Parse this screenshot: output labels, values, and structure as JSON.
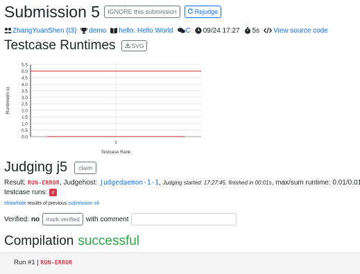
{
  "submission": {
    "title": "Submission 5",
    "ignore_label": "IGNORE this submission",
    "rejudge_label": "Rejudge"
  },
  "meta": {
    "team": "ZhangYuanShen (t3)",
    "contest": "demo",
    "problem": "hello: Hello World",
    "language": "C",
    "time": "09/24 17:27",
    "runtime": "5s",
    "source_link": "View source code"
  },
  "runtimes": {
    "title": "Testcase Runtimes",
    "svg_button": "SVG"
  },
  "chart_data": {
    "type": "bar",
    "categories": [
      "1"
    ],
    "values": [
      0.01
    ],
    "limit_line": 5.0,
    "xlabel": "Testcase Rank",
    "ylabel": "Runtime(in s)",
    "ylim": [
      0,
      5.5
    ],
    "yticks": [
      "0.0",
      "0.5",
      "1.0",
      "1.5",
      "2.0",
      "2.5",
      "3.0",
      "3.5",
      "4.0",
      "4.5",
      "5.0",
      "5.5"
    ],
    "colors": {
      "limit": "#dc3545",
      "bar": "#dc3545",
      "grid": "#e6e6e6"
    }
  },
  "judging": {
    "title": "Judging j5",
    "claim_label": "claim",
    "result_prefix": "Result:",
    "result": "RUN-ERROR",
    "judgehost_prefix": ", Judgehost:",
    "judgehost": "judgedaemon-1-1",
    "started": "Judging started: 17:27:45, finished in 00:01s",
    "maxsum": ", max/sum runtime: 0.01/0.01s",
    "testcase_label": "testcase runs:",
    "testcase_badge": "r",
    "show_hide": "show/hide",
    "prev_text": "results of previous",
    "prev_link": "submission s4",
    "verified_label": "Verified:",
    "verified_value": "no",
    "mark_verified": "mark verified",
    "with_comment": "with comment",
    "comment_value": ""
  },
  "compilation": {
    "title": "Compilation",
    "status": "successful",
    "status_color": "#28a745"
  },
  "run": {
    "label": "Run #1 |",
    "result": "RUN-ERROR"
  }
}
